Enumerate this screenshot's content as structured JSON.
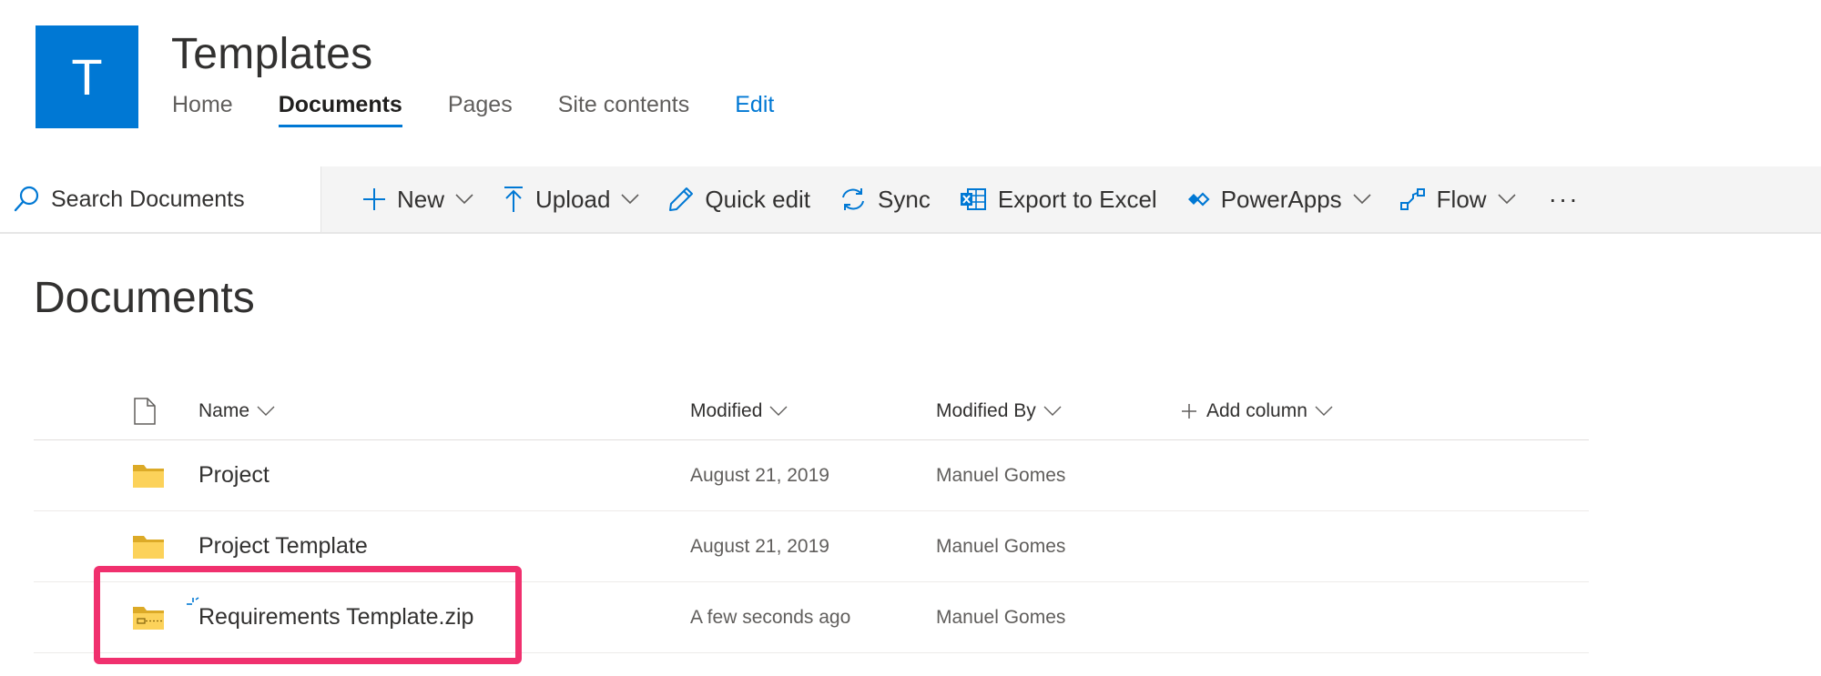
{
  "site": {
    "logo_letter": "T",
    "title": "Templates",
    "nav": [
      {
        "label": "Home"
      },
      {
        "label": "Documents"
      },
      {
        "label": "Pages"
      },
      {
        "label": "Site contents"
      },
      {
        "label": "Edit"
      }
    ],
    "accent_color": "#0078d4"
  },
  "search": {
    "placeholder": "Search Documents"
  },
  "commands": {
    "new": "New",
    "upload": "Upload",
    "quick_edit": "Quick edit",
    "sync": "Sync",
    "export": "Export to Excel",
    "powerapps": "PowerApps",
    "flow": "Flow",
    "more": "···"
  },
  "library": {
    "heading": "Documents",
    "columns": {
      "name": "Name",
      "modified": "Modified",
      "modified_by": "Modified By",
      "add_column": "Add column"
    },
    "rows": [
      {
        "icon": "folder-icon",
        "name": "Project",
        "modified": "August 21, 2019",
        "modified_by": "Manuel Gomes"
      },
      {
        "icon": "folder-icon",
        "name": "Project Template",
        "modified": "August 21, 2019",
        "modified_by": "Manuel Gomes"
      },
      {
        "icon": "zip-folder-icon",
        "name": "Requirements Template.zip",
        "modified": "A few seconds ago",
        "modified_by": "Manuel Gomes",
        "new": true
      }
    ],
    "highlight_color": "#f0306e"
  }
}
